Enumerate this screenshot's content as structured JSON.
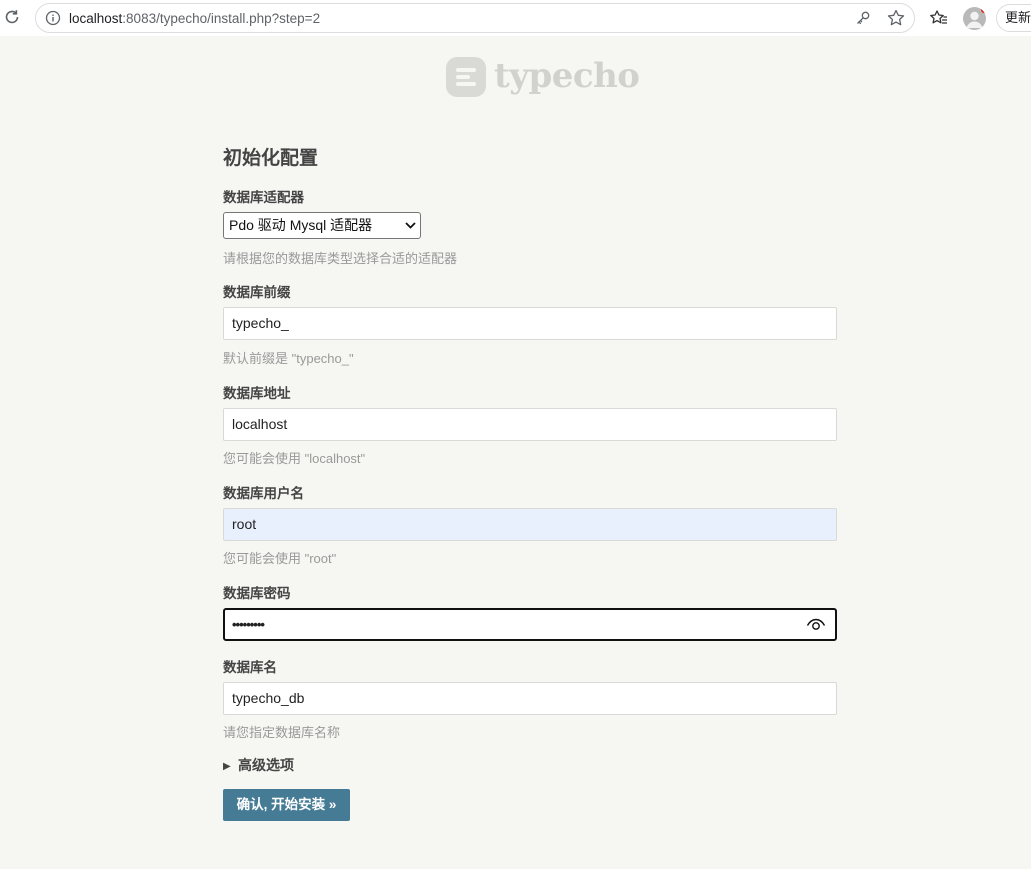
{
  "browser": {
    "url_host": "localhost",
    "url_rest": ":8083/typecho/install.php?step=2",
    "update_label": "更新"
  },
  "logo": {
    "text": "typecho"
  },
  "page": {
    "title": "初始化配置"
  },
  "form": {
    "adapter": {
      "label": "数据库适配器",
      "selected": "Pdo 驱动 Mysql 适配器",
      "description": "请根据您的数据库类型选择合适的适配器"
    },
    "prefix": {
      "label": "数据库前缀",
      "value": "typecho_",
      "description": "默认前缀是 \"typecho_\""
    },
    "host": {
      "label": "数据库地址",
      "value": "localhost",
      "description": "您可能会使用 \"localhost\""
    },
    "user": {
      "label": "数据库用户名",
      "value": "root",
      "description": "您可能会使用 \"root\""
    },
    "password": {
      "label": "数据库密码",
      "masked_value": "•••••••••"
    },
    "database": {
      "label": "数据库名",
      "value": "typecho_db",
      "description": "请您指定数据库名称"
    },
    "advanced_label": "高级选项",
    "submit_label": "确认, 开始安装 »"
  }
}
